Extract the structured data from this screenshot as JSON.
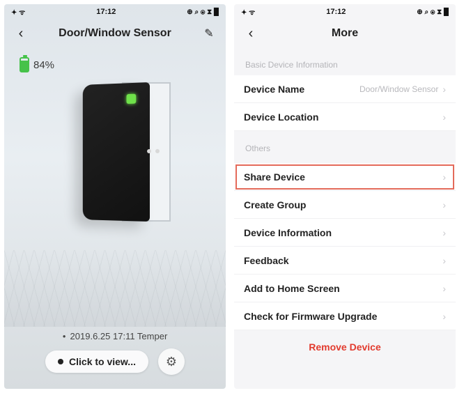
{
  "status": {
    "time": "17:12",
    "left_glyphs": "✦  ᯤ",
    "right_glyphs": "⊕ ⌕ ⦿ ⧗ █"
  },
  "left": {
    "title": "Door/Window Sensor",
    "battery_pct": "84%",
    "log_line": "2019.6.25 17:11 Temper",
    "click_to_view": "Click to view..."
  },
  "right": {
    "title": "More",
    "section_basic": "Basic Device Information",
    "device_name_label": "Device Name",
    "device_name_value": "Door/Window Sensor",
    "device_location_label": "Device Location",
    "section_others": "Others",
    "items": {
      "share": "Share Device",
      "create_group": "Create Group",
      "device_info": "Device Information",
      "feedback": "Feedback",
      "add_home": "Add to Home Screen",
      "firmware": "Check for Firmware Upgrade"
    },
    "remove": "Remove Device"
  }
}
